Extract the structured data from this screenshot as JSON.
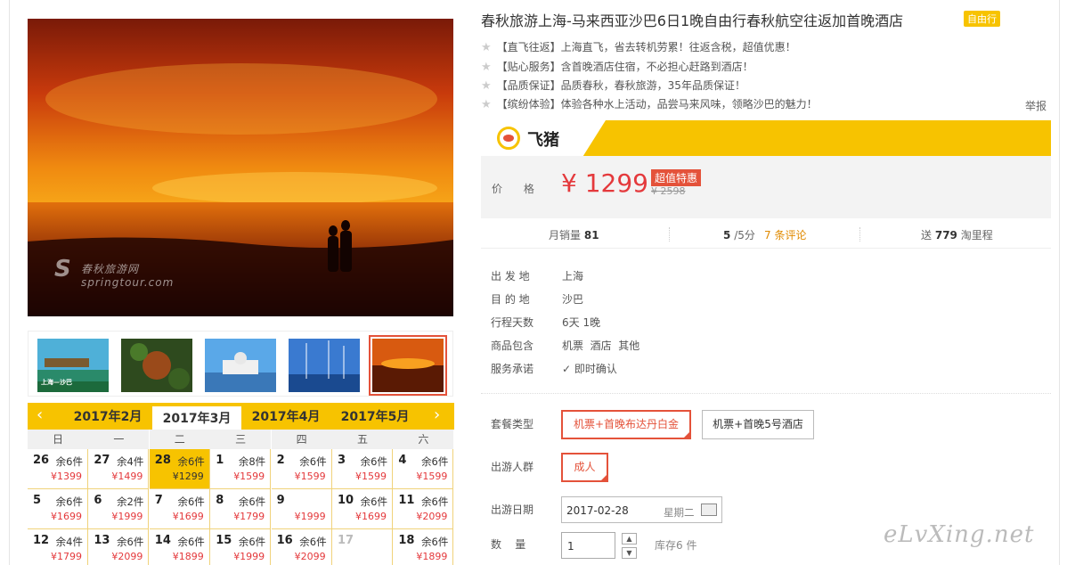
{
  "product": {
    "title": "春秋旅游上海-马来西亚沙巴6日1晚自由行春秋航空往返加首晚酒店",
    "tag": "自由行",
    "image_watermark": {
      "line1": "春秋旅游网",
      "line2": "springtour.com"
    },
    "features": [
      {
        "label": "【直飞往返】",
        "text": "上海直飞，省去转机劳累！往返含税，超值优惠！"
      },
      {
        "label": "【贴心服务】",
        "text": "含首晚酒店住宿，不必担心赶路到酒店！"
      },
      {
        "label": "【品质保证】",
        "text": "品质春秋，春秋旅游，35年品质保证！"
      },
      {
        "label": "【缤纷体验】",
        "text": "体验各种水上活动，品尝马来风味，领略沙巴的魅力！"
      }
    ],
    "report": "举报"
  },
  "thumbnails": [
    {
      "icon": "resort-thumb",
      "caption": "上海—沙巴"
    },
    {
      "icon": "orangutan-thumb",
      "caption": ""
    },
    {
      "icon": "mosque-thumb",
      "caption": ""
    },
    {
      "icon": "marina-thumb",
      "caption": ""
    },
    {
      "icon": "sunset-thumb",
      "caption": ""
    }
  ],
  "brand": {
    "name": "飞猪"
  },
  "price": {
    "label": "价  格",
    "current": "¥ 1299",
    "tag": "超值特惠",
    "original": "¥ 2598"
  },
  "stats": {
    "sales_label": "月销量",
    "sales": "81",
    "rating": "5",
    "rating_of": "/5分",
    "reviews": "7 条评论",
    "miles_label": "送",
    "miles": "779",
    "miles_unit": "淘里程"
  },
  "attributes": [
    {
      "key": "出 发 地",
      "value": "上海"
    },
    {
      "key": "目 的 地",
      "value": "沙巴"
    },
    {
      "key": "行程天数",
      "value": "6天 1晚"
    },
    {
      "key": "商品包含",
      "value": "机票  酒店  其他"
    },
    {
      "key": "服务承诺",
      "value": "即时确认"
    }
  ],
  "options": {
    "package_label": "套餐类型",
    "packages": [
      "机票+首晚布达丹白金",
      "机票+首晚5号酒店"
    ],
    "group_label": "出游人群",
    "groups": [
      "成人"
    ],
    "date_label": "出游日期",
    "date": "2017-02-28",
    "weekday": "星期二",
    "qty_label": "数    量",
    "qty": "1",
    "stock": "库存6 件"
  },
  "calendar": {
    "months": [
      "2017年2月",
      "2017年3月",
      "2017年4月",
      "2017年5月"
    ],
    "active_month": 1,
    "weekdays": [
      "日",
      "一",
      "二",
      "三",
      "四",
      "五",
      "六"
    ],
    "rows": [
      [
        {
          "day": "26",
          "stock": "余6件",
          "price": "¥1399"
        },
        {
          "day": "27",
          "stock": "余4件",
          "price": "¥1499"
        },
        {
          "day": "28",
          "stock": "余6件",
          "price": "¥1299",
          "selected": true
        },
        {
          "day": "1",
          "stock": "余8件",
          "price": "¥1599"
        },
        {
          "day": "2",
          "stock": "余6件",
          "price": "¥1599"
        },
        {
          "day": "3",
          "stock": "余6件",
          "price": "¥1599"
        },
        {
          "day": "4",
          "stock": "余6件",
          "price": "¥1599"
        }
      ],
      [
        {
          "day": "5",
          "stock": "余6件",
          "price": "¥1699"
        },
        {
          "day": "6",
          "stock": "余2件",
          "price": "¥1999"
        },
        {
          "day": "7",
          "stock": "余6件",
          "price": "¥1699"
        },
        {
          "day": "8",
          "stock": "余6件",
          "price": "¥1799"
        },
        {
          "day": "9",
          "stock": "",
          "price": "¥1999"
        },
        {
          "day": "10",
          "stock": "余6件",
          "price": "¥1699"
        },
        {
          "day": "11",
          "stock": "余6件",
          "price": "¥2099"
        }
      ],
      [
        {
          "day": "12",
          "stock": "余4件",
          "price": "¥1799"
        },
        {
          "day": "13",
          "stock": "余6件",
          "price": "¥2099"
        },
        {
          "day": "14",
          "stock": "余6件",
          "price": "¥1899"
        },
        {
          "day": "15",
          "stock": "余6件",
          "price": "¥1999"
        },
        {
          "day": "16",
          "stock": "余6件",
          "price": "¥2099"
        },
        {
          "day": "17",
          "stock": "",
          "price": "",
          "disabled": true
        },
        {
          "day": "18",
          "stock": "余6件",
          "price": "¥1899"
        }
      ]
    ]
  },
  "site_watermark": "eLvXing.net"
}
